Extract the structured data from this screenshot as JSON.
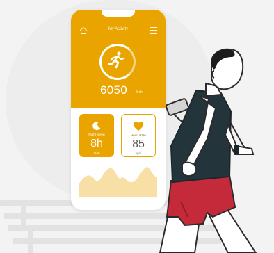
{
  "app": {
    "title": "My Activity",
    "home_icon": "home-icon",
    "menu_icon": "menu-icon"
  },
  "activity": {
    "icon": "runner-icon",
    "steps": "6050",
    "steps_unit": "Sch."
  },
  "cards": {
    "sleep": {
      "icon": "moon-icon",
      "label": "Night Sleep",
      "value": "8h",
      "sub": "00m"
    },
    "heart": {
      "icon": "heart-icon",
      "label": "Heart Rate",
      "value": "85",
      "sub": "bpm"
    }
  },
  "colors": {
    "accent": "#e9a400",
    "chart_fill": "#f7dfa6",
    "shirt": "#23343b",
    "shorts": "#c42a3a",
    "skin": "#ffffff",
    "background": "#f3f3f3"
  }
}
